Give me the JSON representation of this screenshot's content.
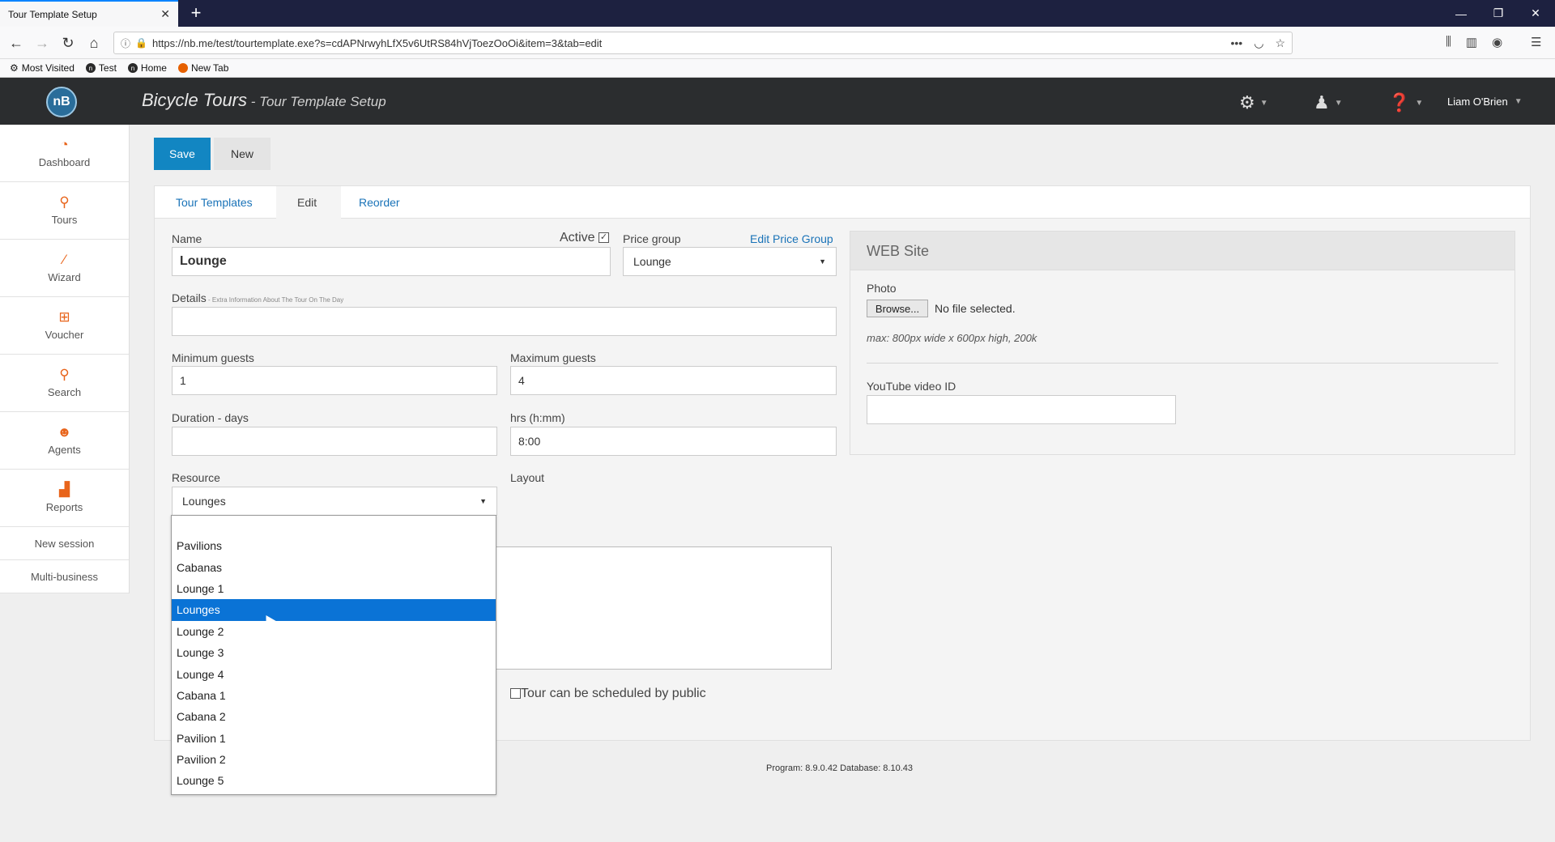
{
  "browser": {
    "tab_title": "Tour Template Setup",
    "url": "https://nb.me/test/tourtemplate.exe?s=cdAPNrwyhLfX5v6UtRS84hVjToezOoOi&item=3&tab=edit",
    "bookmarks": [
      {
        "label": "Most Visited",
        "icon": "gear-icon"
      },
      {
        "label": "Test",
        "icon": "nb-logo-icon"
      },
      {
        "label": "Home",
        "icon": "nb-logo-icon"
      },
      {
        "label": "New Tab",
        "icon": "firefox-icon"
      }
    ]
  },
  "header": {
    "logo": "nB",
    "business": "Bicycle Tours",
    "separator": " - ",
    "page": "Tour Template Setup",
    "user": "Liam O'Brien"
  },
  "sidebar": {
    "items": [
      {
        "label": "Dashboard",
        "icon": "dashboard-icon"
      },
      {
        "label": "Tours",
        "icon": "tours-icon"
      },
      {
        "label": "Wizard",
        "icon": "wizard-icon"
      },
      {
        "label": "Voucher",
        "icon": "gift-icon"
      },
      {
        "label": "Search",
        "icon": "search-icon"
      },
      {
        "label": "Agents",
        "icon": "agent-icon"
      },
      {
        "label": "Reports",
        "icon": "chart-icon"
      }
    ],
    "links": [
      "New session",
      "Multi-business"
    ]
  },
  "toolbar": {
    "save": "Save",
    "new": "New"
  },
  "tabs": [
    "Tour Templates",
    "Edit",
    "Reorder"
  ],
  "form": {
    "name_label": "Name",
    "name_value": "Lounge",
    "active_label": "Active",
    "active_checked": true,
    "price_group_label": "Price group",
    "price_group_value": "Lounge",
    "edit_price_group": "Edit Price Group",
    "details_label": "Details",
    "details_hint": " - Extra Information About The Tour On The Day",
    "details_value": "",
    "min_guests_label": "Minimum guests",
    "min_guests_value": "1",
    "max_guests_label": "Maximum guests",
    "max_guests_value": "4",
    "duration_label": "Duration - days",
    "duration_value": "",
    "hrs_label": "hrs (h:mm)",
    "hrs_value": "8:00",
    "resource_label": "Resource",
    "resource_value": "Lounges",
    "layout_label": "Layout",
    "schedule_label": "Tour can be scheduled by public",
    "schedule_checked": false
  },
  "resource_options": [
    "Pavilions",
    "Cabanas",
    "Lounge 1",
    "Lounges",
    "Lounge 2",
    "Lounge 3",
    "Lounge 4",
    "Cabana 1",
    "Cabana 2",
    "Pavilion 1",
    "Pavilion 2",
    "Lounge 5"
  ],
  "resource_selected_index": 3,
  "web": {
    "title": "WEB Site",
    "photo_label": "Photo",
    "browse": "Browse...",
    "no_file": "No file selected.",
    "hint": "max: 800px wide x 600px high, 200k",
    "youtube_label": "YouTube video ID",
    "youtube_value": ""
  },
  "footer": "Program: 8.9.0.42 Database: 8.10.43",
  "colors": {
    "primary": "#1286c2",
    "header_bg": "#2b2d2f",
    "sidebar_icon": "#e8641b",
    "selected": "#0a73d6",
    "link": "#1a73b8"
  }
}
